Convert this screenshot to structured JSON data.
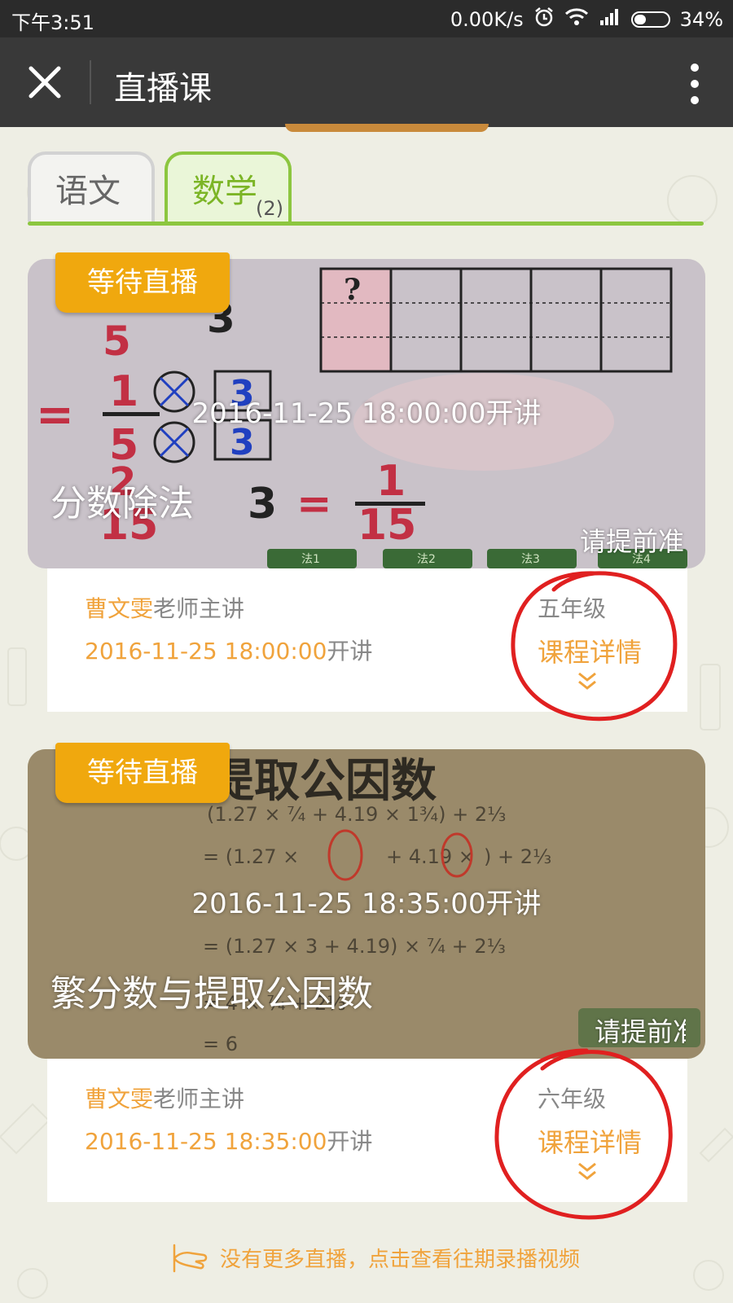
{
  "status_bar": {
    "time": "下午3:51",
    "network_speed": "0.00K/s",
    "battery": "34%"
  },
  "titlebar": {
    "title": "直播课"
  },
  "tabs": [
    {
      "label": "语文",
      "selected": false
    },
    {
      "label": "数学",
      "count": "(2)",
      "selected": true
    }
  ],
  "courses": [
    {
      "badge": "等待直播",
      "start_overlay": "2016-11-25 18:00:00开讲",
      "title": "分数除法",
      "reminder": "请提前准",
      "teacher_name": "曹文雯",
      "teacher_suffix": "老师主讲",
      "start_value": "2016-11-25 18:00:00",
      "start_suffix": "开讲",
      "grade": "五年级",
      "detail_label": "课程详情"
    },
    {
      "badge": "等待直播",
      "start_overlay": "2016-11-25 18:35:00开讲",
      "title": "繁分数与提取公因数",
      "reminder": "请提前准",
      "teacher_name": "曹文雯",
      "teacher_suffix": "老师主讲",
      "start_value": "2016-11-25 18:35:00",
      "start_suffix": "开讲",
      "grade": "六年级",
      "detail_label": "课程详情"
    }
  ],
  "thumbnail_text": {
    "c1_q": "?",
    "c1_methods": [
      "法1",
      "法2",
      "法3",
      "法4"
    ],
    "c2_heading": "提取公因数"
  },
  "footer": {
    "text": "没有更多直播，点击查看往期录播视频"
  },
  "colors": {
    "accent_orange": "#f0a33c",
    "badge_orange": "#f0a80e",
    "tab_green": "#8cc63f",
    "annotation_red": "#e02020"
  }
}
